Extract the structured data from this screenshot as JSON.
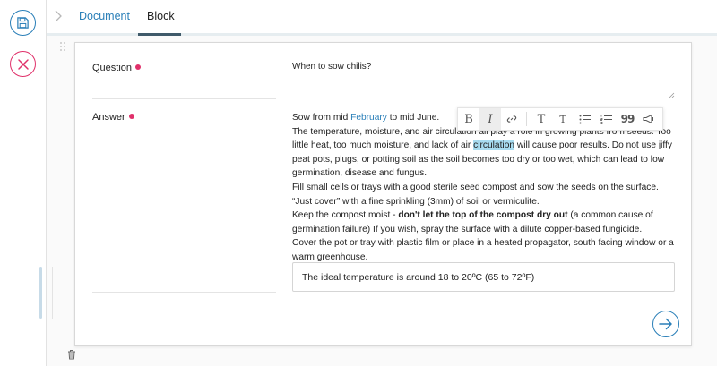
{
  "nav": {
    "breadcrumb_tabs": [
      {
        "label": "Document"
      },
      {
        "label": "Block"
      }
    ]
  },
  "form": {
    "question": {
      "label": "Question",
      "value": "When to sow chilis?"
    },
    "answer": {
      "label": "Answer",
      "line1_pre": "Sow from mid ",
      "line1_link": "February",
      "line1_post": " to mid June.",
      "p2_pre": "The temperature, moisture, and air circulation all play a role in growing plants from seeds. Too little heat, too much moisture, and lack of air ",
      "p2_highlight": "circulation",
      "p2_post": " will cause poor results. Do not use jiffy peat pots, plugs, or potting soil as the soil becomes too dry or too wet, which can lead to low germination, disease and fungus.",
      "p3": "Fill small cells or trays with a good sterile seed compost and sow the seeds on the surface. “Just cover” with a fine sprinkling (3mm) of soil or vermiculite.",
      "p4_pre": "Keep the compost moist - ",
      "p4_bold": "don't let the top of the compost dry out",
      "p4_post": " (a common cause of germination failure) If you wish, spray the surface with a dilute copper-based fungicide.",
      "p5": "Cover the pot or tray with plastic film or place in a heated propagator, south facing window or a warm greenhouse.",
      "callout": "The ideal temperature is around 18 to 20ºC (65 to 72ºF)"
    }
  },
  "toolbar": {
    "bold": "B",
    "italic": "I",
    "heading_large": "T",
    "heading_small": "T",
    "quote": "99"
  },
  "colors": {
    "accent": "#2a7fb8",
    "danger": "#e0306a",
    "highlight": "#a8dcf0"
  }
}
